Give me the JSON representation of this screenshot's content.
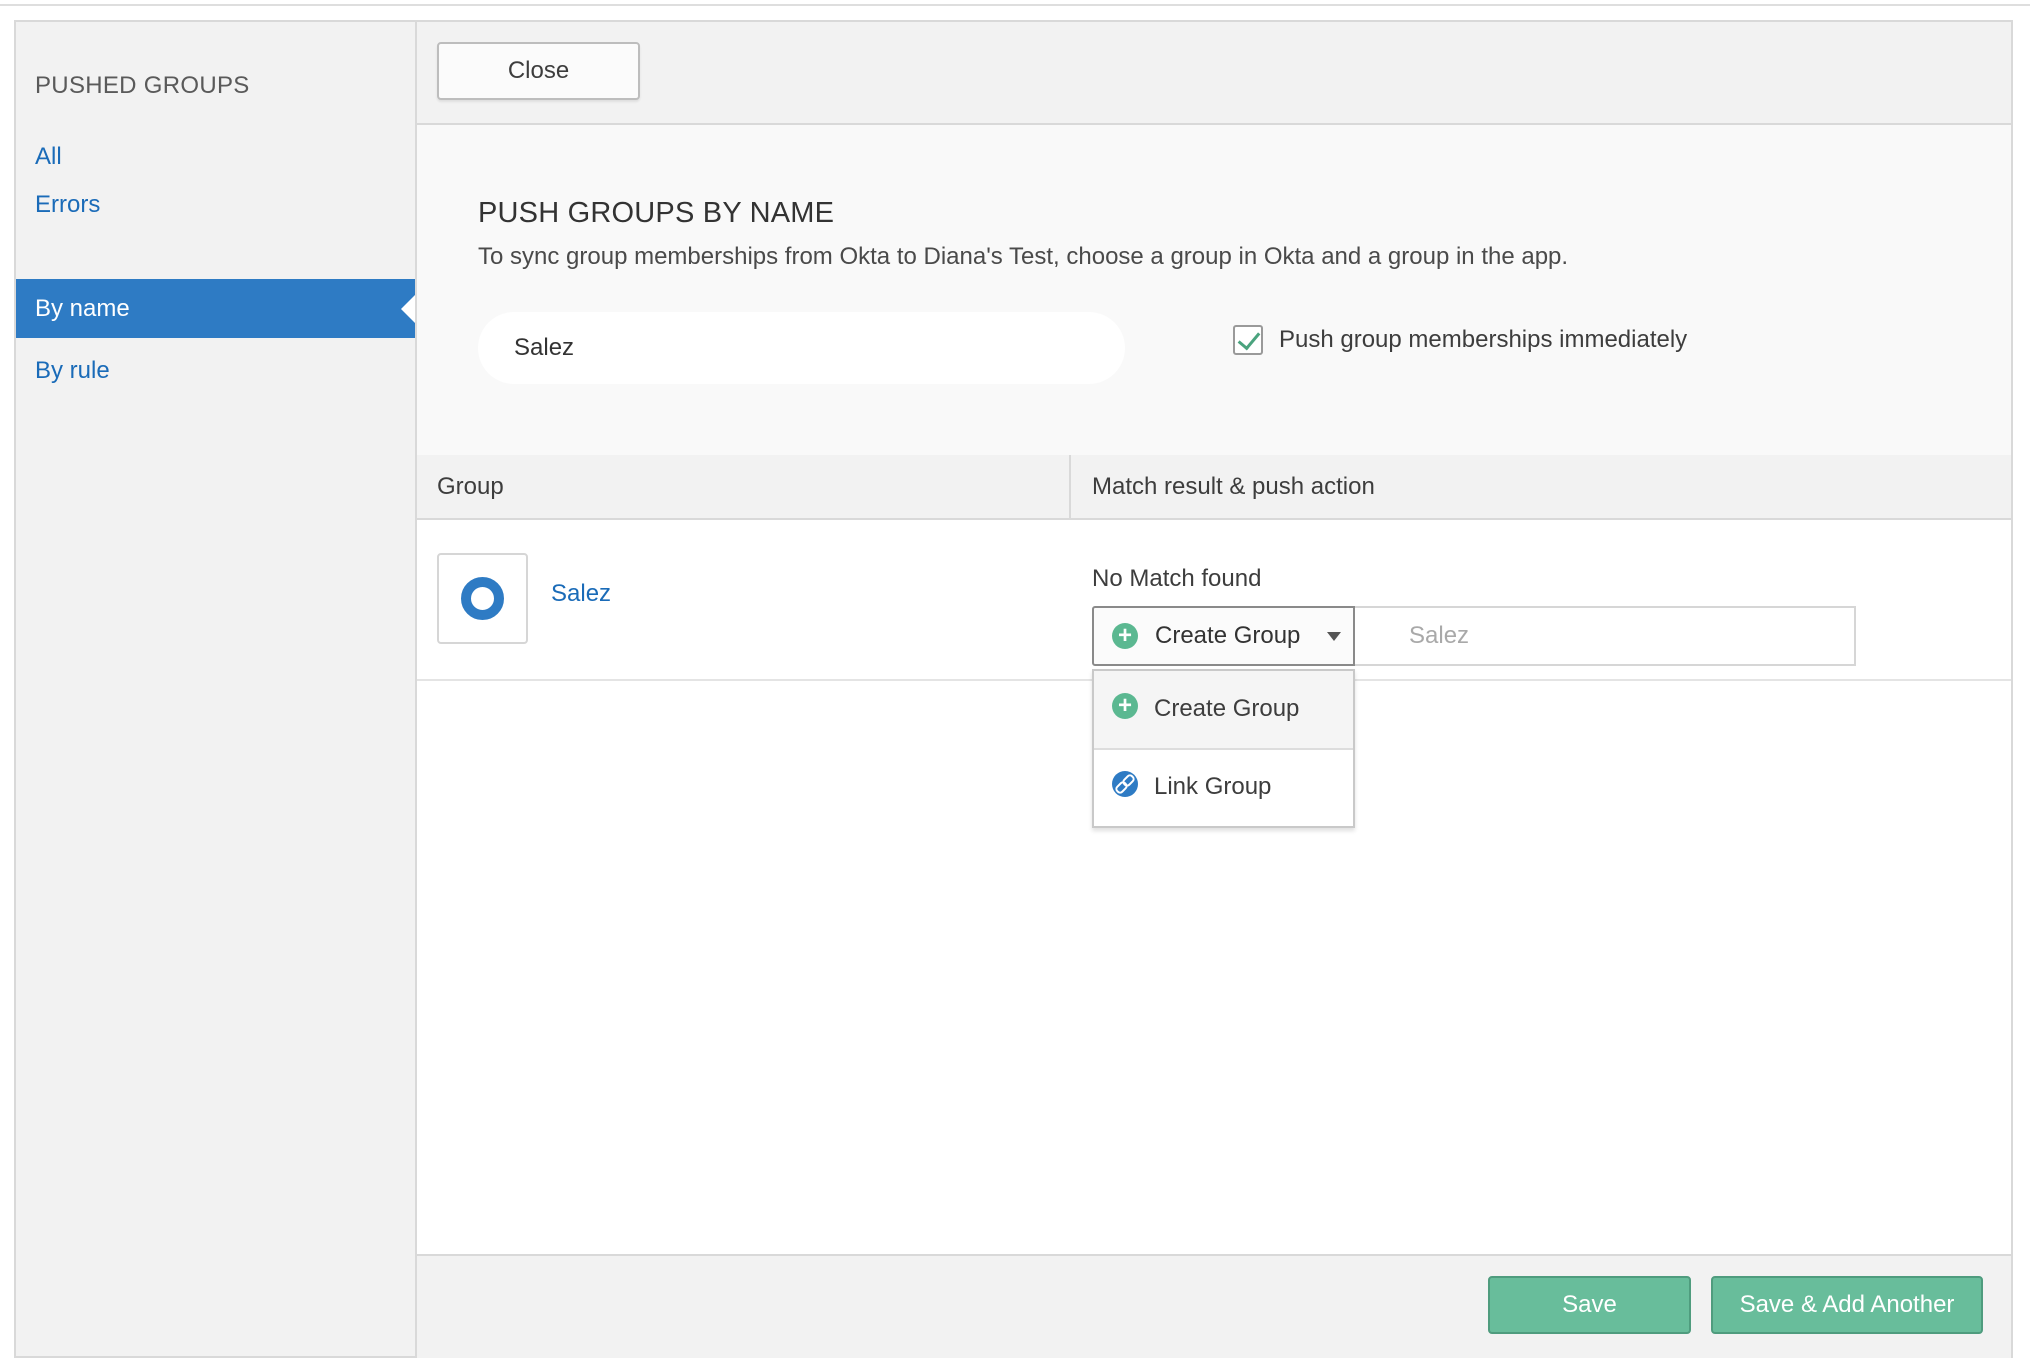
{
  "sidebar": {
    "title": "PUSHED GROUPS",
    "items": [
      {
        "label": "All"
      },
      {
        "label": "Errors"
      },
      {
        "label": "By name"
      },
      {
        "label": "By rule"
      }
    ],
    "active_item": "By name"
  },
  "toolbar": {
    "close_label": "Close"
  },
  "push_panel": {
    "title": "PUSH GROUPS BY NAME",
    "description": "To sync group memberships from Okta to Diana's Test, choose a group in Okta and a group in the app.",
    "search_value": "Salez",
    "checkbox_label": "Push group memberships immediately",
    "checkbox_checked": true
  },
  "table": {
    "columns": [
      "Group",
      "Match result & push action"
    ],
    "rows": [
      {
        "group_name": "Salez",
        "match_result": "No Match found",
        "action_selected": "Create Group",
        "target_name_placeholder": "Salez"
      }
    ]
  },
  "dropdown": {
    "options": [
      {
        "label": "Create Group",
        "icon": "plus-circle-icon"
      },
      {
        "label": "Link Group",
        "icon": "link-icon"
      }
    ]
  },
  "footer": {
    "save_label": "Save",
    "save_add_label": "Save & Add Another"
  },
  "colors": {
    "accent_blue": "#2e7bc4",
    "link_blue": "#1a6bb8",
    "save_green": "#68bd9b",
    "check_green": "#4aa37e"
  }
}
